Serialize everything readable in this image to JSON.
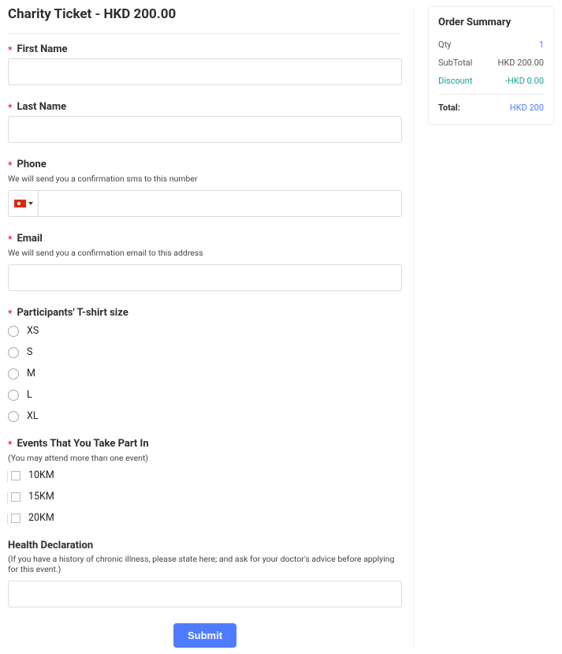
{
  "form": {
    "title": "Charity Ticket - HKD 200.00",
    "first_name": {
      "label": "First Name"
    },
    "last_name": {
      "label": "Last Name"
    },
    "phone": {
      "label": "Phone",
      "help": "We will send you a confirmation sms to this number"
    },
    "email": {
      "label": "Email",
      "help": "We will send you a confirmation email to this address"
    },
    "tshirt": {
      "label": "Participants' T-shirt size",
      "options": [
        "XS",
        "S",
        "M",
        "L",
        "XL"
      ]
    },
    "events": {
      "label": "Events That You Take Part In",
      "help": "(You may attend more than one event)",
      "options": [
        "10KM",
        "15KM",
        "20KM"
      ]
    },
    "health": {
      "label": "Health Declaration",
      "help": "(If you have a history of chronic illness, please state here; and ask for your doctor's advice before applying for this event.)"
    },
    "submit": "Submit"
  },
  "order": {
    "title": "Order Summary",
    "qty_label": "Qty",
    "qty_value": "1",
    "subtotal_label": "SubTotal",
    "subtotal_value": "HKD 200.00",
    "discount_label": "Discount",
    "discount_value": "-HKD 0.00",
    "total_label": "Total:",
    "total_value": "HKD 200"
  }
}
